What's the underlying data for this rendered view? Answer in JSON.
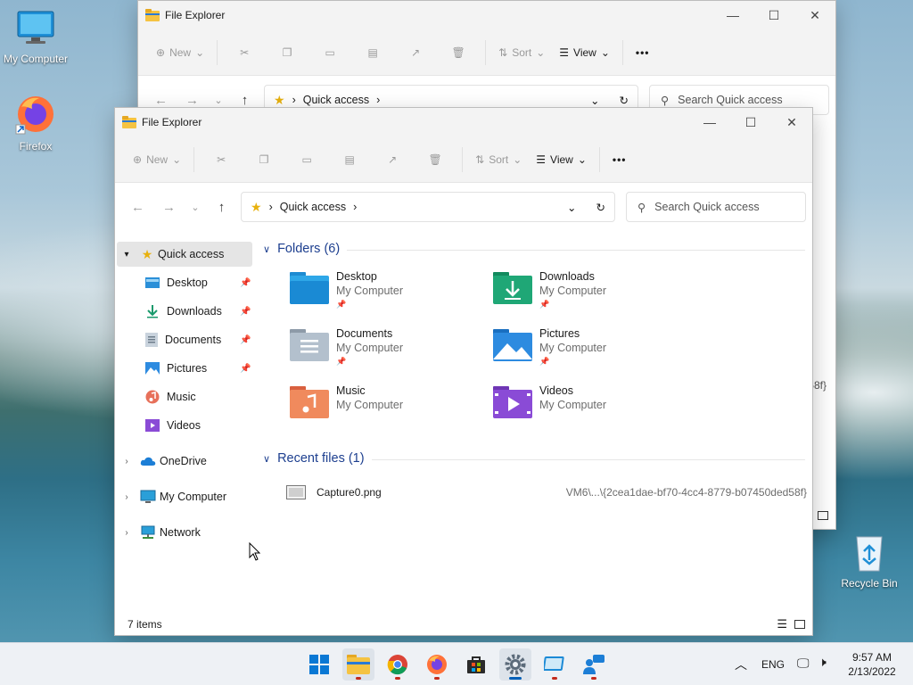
{
  "desktop": {
    "icons": [
      {
        "label": "My Computer",
        "icon": "monitor-icon"
      },
      {
        "label": "Firefox",
        "icon": "firefox-icon"
      },
      {
        "label": "Recycle Bin",
        "icon": "recycle-bin-icon"
      }
    ]
  },
  "back_window": {
    "title": "File Explorer",
    "toolbar": {
      "new_label": "New",
      "sort_label": "Sort",
      "view_label": "View"
    },
    "address": {
      "path_label": "Quick access"
    },
    "search": {
      "placeholder": "Search Quick access"
    },
    "partial_text": "58f}"
  },
  "front_window": {
    "title": "File Explorer",
    "toolbar": {
      "new_label": "New",
      "sort_label": "Sort",
      "view_label": "View",
      "more_label": "•••"
    },
    "address": {
      "path_label": "Quick access"
    },
    "search": {
      "placeholder": "Search Quick access"
    },
    "sidebar": {
      "quick_access": "Quick access",
      "items": [
        {
          "label": "Desktop",
          "icon": "desktop-folder-icon",
          "pinned": true
        },
        {
          "label": "Downloads",
          "icon": "download-icon",
          "pinned": true
        },
        {
          "label": "Documents",
          "icon": "documents-icon",
          "pinned": true
        },
        {
          "label": "Pictures",
          "icon": "pictures-icon",
          "pinned": true
        },
        {
          "label": "Music",
          "icon": "music-icon",
          "pinned": false
        },
        {
          "label": "Videos",
          "icon": "videos-icon",
          "pinned": false
        }
      ],
      "onedrive": "OneDrive",
      "my_computer": "My Computer",
      "network": "Network"
    },
    "folders_section": {
      "heading": "Folders (6)",
      "items": [
        {
          "name": "Desktop",
          "location": "My Computer",
          "pinned": true
        },
        {
          "name": "Downloads",
          "location": "My Computer",
          "pinned": true
        },
        {
          "name": "Documents",
          "location": "My Computer",
          "pinned": true
        },
        {
          "name": "Pictures",
          "location": "My Computer",
          "pinned": true
        },
        {
          "name": "Music",
          "location": "My Computer",
          "pinned": false
        },
        {
          "name": "Videos",
          "location": "My Computer",
          "pinned": false
        }
      ]
    },
    "recent_section": {
      "heading": "Recent files (1)",
      "files": [
        {
          "name": "Capture0.png",
          "path": "VM6\\...\\{2cea1dae-bf70-4cc4-8779-b07450ded58f}"
        }
      ]
    },
    "status": {
      "item_count": "7 items"
    }
  },
  "taskbar": {
    "apps": [
      "start-icon",
      "file-explorer-icon",
      "chrome-icon",
      "firefox-icon",
      "store-icon",
      "settings-icon",
      "remote-desktop-icon",
      "people-icon"
    ],
    "language": "ENG",
    "time": "9:57 AM",
    "date": "2/13/2022"
  },
  "colors": {
    "accent": "#005fb8",
    "section_heading": "#1d3f8f",
    "folder_yellow": "#f5c342"
  }
}
